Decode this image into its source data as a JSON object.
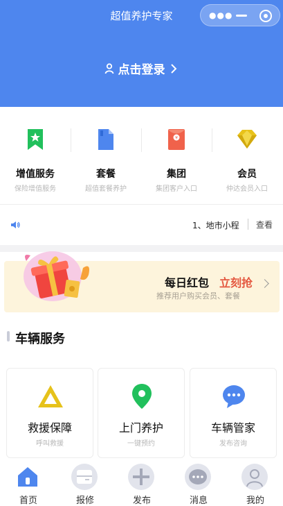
{
  "header": {
    "title": "超值养护专家",
    "login_label": "点击登录",
    "capsule": {
      "more_icon": "more-dots-icon",
      "minimize_icon": "minimize-icon",
      "close_icon": "target-circle-icon"
    },
    "bg_color": "#4e86ee"
  },
  "menu": [
    {
      "label": "增值服务",
      "sub": "保险增值服务",
      "icon": "bookmark-star-icon",
      "color": "#21c05c"
    },
    {
      "label": "套餐",
      "sub": "超值套餐养护",
      "icon": "document-icon",
      "color": "#4e86ee"
    },
    {
      "label": "集团",
      "sub": "集团客户入口",
      "icon": "red-envelope-icon",
      "color": "#f0624b"
    },
    {
      "label": "会员",
      "sub": "仲达会员入口",
      "icon": "diamond-icon",
      "color": "#e8c21a"
    }
  ],
  "notice": {
    "text": "1、地市小程",
    "more": "查看"
  },
  "banner": {
    "title": "每日红包",
    "action": "立刻抢",
    "subtitle": "推荐用户购买会员、套餐"
  },
  "section": {
    "title": "车辆服务"
  },
  "services": [
    {
      "label": "救援保障",
      "sub": "呼叫救援",
      "icon": "warning-triangle-icon"
    },
    {
      "label": "上门养护",
      "sub": "一键预约",
      "icon": "location-pin-icon"
    },
    {
      "label": "车辆管家",
      "sub": "发布咨询",
      "icon": "chat-bubble-icon"
    }
  ],
  "tabs": [
    {
      "label": "首页",
      "icon": "home-icon",
      "active": true
    },
    {
      "label": "报修",
      "icon": "repair-icon",
      "active": false
    },
    {
      "label": "发布",
      "icon": "plus-icon",
      "active": false
    },
    {
      "label": "消息",
      "icon": "message-icon",
      "active": false
    },
    {
      "label": "我的",
      "icon": "user-icon",
      "active": false
    }
  ]
}
